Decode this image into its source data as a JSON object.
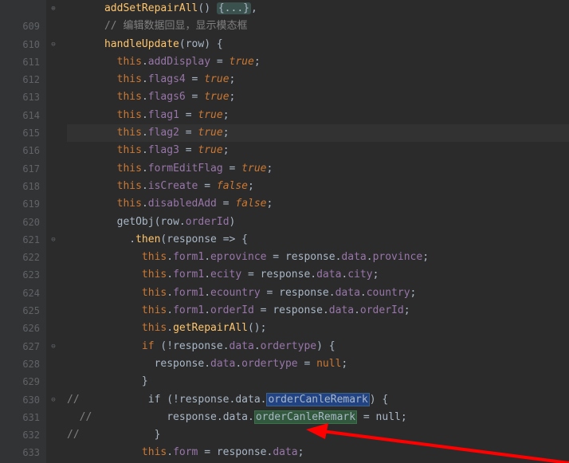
{
  "gutter": [
    "",
    "609",
    "610",
    "611",
    "612",
    "613",
    "614",
    "615",
    "616",
    "617",
    "618",
    "619",
    "620",
    "621",
    "622",
    "623",
    "624",
    "625",
    "626",
    "627",
    "628",
    "629",
    "630",
    "631",
    "632",
    "633"
  ],
  "code": {
    "l0_fn": "addSetRepairAll",
    "l0_folded": "{...}",
    "l1_comment": "// 编辑数据回显，显示模态框",
    "l2_fn": "handleUpdate",
    "l2_param": "row",
    "l3_this": "this",
    "l3_prop": "addDisplay",
    "l3_val": "true",
    "l4_this": "this",
    "l4_prop": "flags4",
    "l4_val": "true",
    "l5_this": "this",
    "l5_prop": "flags6",
    "l5_val": "true",
    "l6_this": "this",
    "l6_prop": "flag1",
    "l6_val": "true",
    "l7_this": "this",
    "l7_prop": "flag2",
    "l7_val": "true",
    "l8_this": "this",
    "l8_prop": "flag3",
    "l8_val": "true",
    "l9_this": "this",
    "l9_prop": "formEditFlag",
    "l9_val": "true",
    "l10_this": "this",
    "l10_prop": "isCreate",
    "l10_val": "false",
    "l11_this": "this",
    "l11_prop": "disabledAdd",
    "l11_val": "false",
    "l12_fn": "getObj",
    "l12_arg1": "row",
    "l12_arg2": "orderId",
    "l13_fn": "then",
    "l13_param": "response",
    "l14_this": "this",
    "l14_p1": "form1",
    "l14_p2": "eprovince",
    "l14_r": "response",
    "l14_d": "data",
    "l14_f": "province",
    "l15_this": "this",
    "l15_p1": "form1",
    "l15_p2": "ecity",
    "l15_r": "response",
    "l15_d": "data",
    "l15_f": "city",
    "l16_this": "this",
    "l16_p1": "form1",
    "l16_p2": "ecountry",
    "l16_r": "response",
    "l16_d": "data",
    "l16_f": "country",
    "l17_this": "this",
    "l17_p1": "form1",
    "l17_p2": "orderId",
    "l17_r": "response",
    "l17_d": "data",
    "l17_f": "orderId",
    "l18_this": "this",
    "l18_fn": "getRepairAll",
    "l19_kw": "if",
    "l19_r": "response",
    "l19_d": "data",
    "l19_f": "ordertype",
    "l20_r": "response",
    "l20_d": "data",
    "l20_f": "ordertype",
    "l20_val": "null",
    "l22_cm": "//",
    "l22_kw": "if",
    "l22_r": "response",
    "l22_d": "data",
    "l22_f": "orderCanleRemark",
    "l23_cm": "//",
    "l23_r": "response",
    "l23_d": "data",
    "l23_f": "orderCanleRemark",
    "l23_val": "null",
    "l24_cm": "//",
    "l25_this": "this",
    "l25_p": "form",
    "l25_r": "response",
    "l25_d": "data"
  }
}
